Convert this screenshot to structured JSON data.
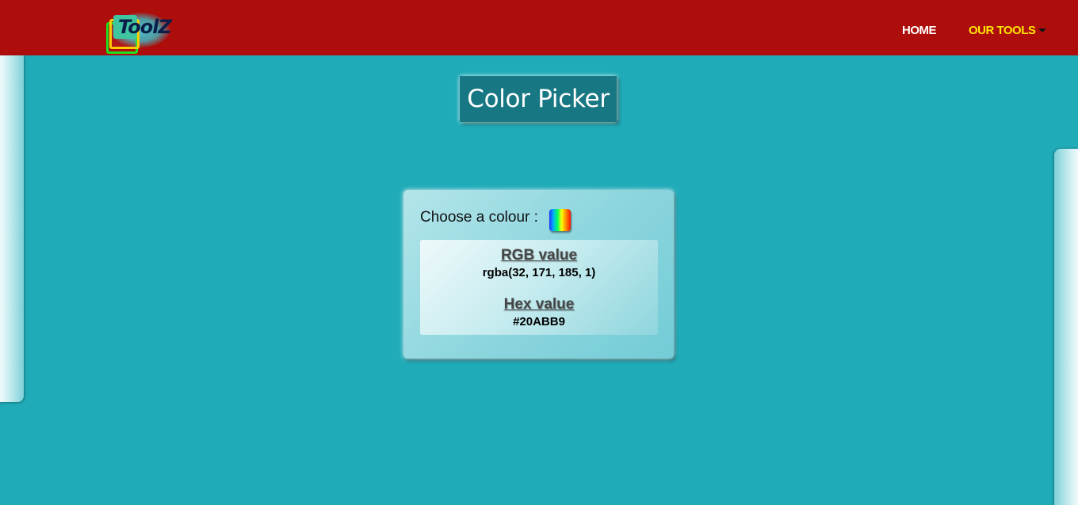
{
  "header": {
    "logo_text": "ToolZ",
    "nav": {
      "home_label": "HOME",
      "tools_label": "OUR TOOLS"
    }
  },
  "page": {
    "title": "Color Picker"
  },
  "picker": {
    "choose_label": "Choose a colour :",
    "rgb_heading": "RGB value",
    "rgb_value": "rgba(32, 171, 185, 1)",
    "hex_heading": "Hex value",
    "hex_value": "#20ABB9"
  },
  "colors": {
    "page_background": "#20abb9",
    "navbar": "#ad0d0b",
    "nav_active": "#ffe600",
    "title_box": "#177883"
  },
  "icons": {
    "logo": "toolz-logo-icon",
    "dropdown": "caret-down-icon",
    "swatch": "color-input-swatch"
  }
}
